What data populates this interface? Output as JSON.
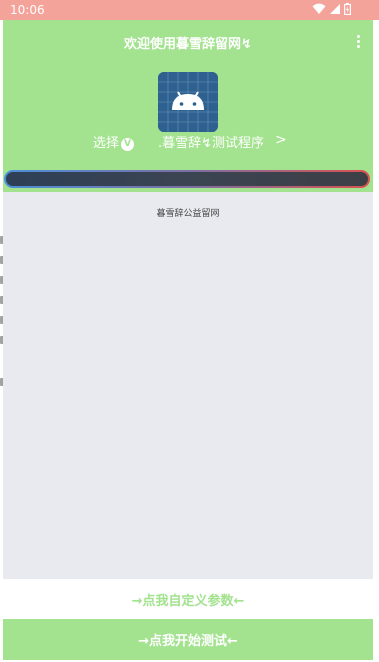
{
  "status_bar": {
    "time": "10:06",
    "icons": [
      "wifi-icon",
      "signal-icon",
      "battery-icon"
    ]
  },
  "dialog": {
    "title": "欢迎使用暮雪辞留网↯",
    "select_label": "选择",
    "select_badge": "V",
    "program_label": ".暮雪辞↯测试程序",
    "chevron": ">",
    "content_title": "暮雪辞公益留网",
    "custom_button": "→点我自定义参数←",
    "start_button": "→点我开始测试←"
  },
  "colors": {
    "header_green": "#a3e28f",
    "status_bar": "#f4a39b",
    "content_bg": "#e9eaef"
  }
}
